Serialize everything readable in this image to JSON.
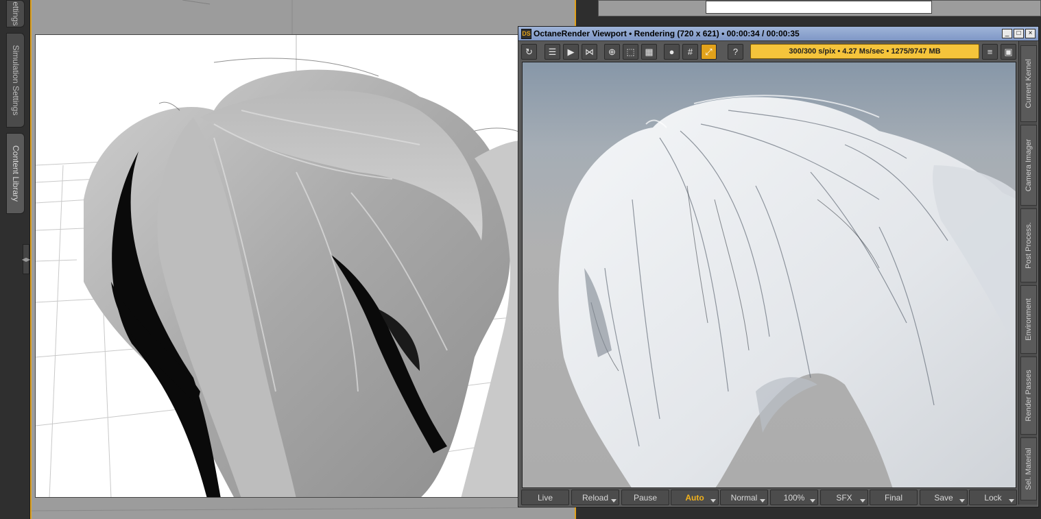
{
  "left_tabs": [
    {
      "label": "ettings"
    },
    {
      "label": "Simulation Settings"
    },
    {
      "label": "Content Library"
    }
  ],
  "octane": {
    "logo": "DS",
    "title": "OctaneRender Viewport • Rendering (720 x 621) • 00:00:34 / 00:00:35",
    "window_buttons": {
      "minimize": "_",
      "maximize": "□",
      "close": "×"
    },
    "status": "300/300 s/pix • 4.27 Ms/sec • 1275/9747 MB",
    "toolbar_icons": [
      "refresh-icon",
      "start-all-icon",
      "send-icon",
      "share-icon",
      "target-icon",
      "focus-region-icon",
      "grid-layout-icon",
      "record-icon",
      "table-grid-icon",
      "expand-icon",
      "help-icon",
      "list-icon",
      "camera-icon"
    ],
    "side_tabs": [
      {
        "label": "Current Kernel"
      },
      {
        "label": "Camera Imager"
      },
      {
        "label": "Post Process."
      },
      {
        "label": "Environment"
      },
      {
        "label": "Render Passes"
      },
      {
        "label": "Sel. Material"
      }
    ],
    "bottom_buttons": [
      {
        "label": "Live",
        "dropdown": false
      },
      {
        "label": "Reload",
        "dropdown": true
      },
      {
        "label": "Pause",
        "dropdown": false
      },
      {
        "label": "Auto",
        "dropdown": true,
        "active": true
      },
      {
        "label": "Normal",
        "dropdown": true
      },
      {
        "label": "100%",
        "dropdown": true
      },
      {
        "label": "SFX",
        "dropdown": true
      },
      {
        "label": "Final",
        "dropdown": false
      },
      {
        "label": "Save",
        "dropdown": true
      },
      {
        "label": "Lock",
        "dropdown": true
      }
    ],
    "accent_color": "#e2a21b",
    "status_color": "#f5c43b"
  }
}
